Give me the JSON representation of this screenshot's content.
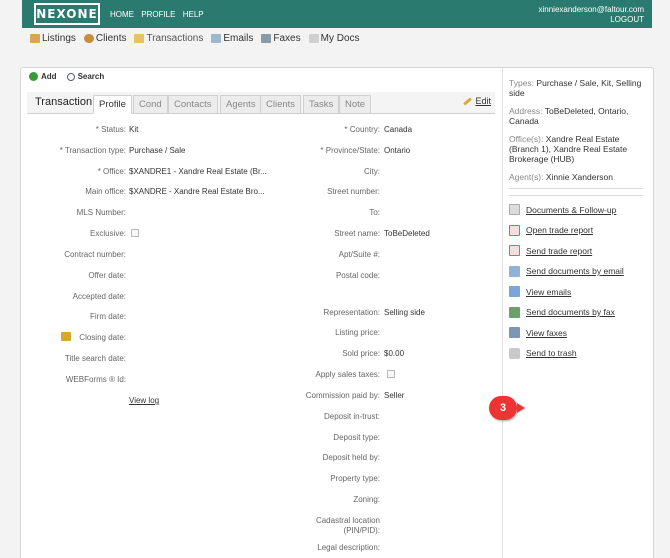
{
  "header": {
    "logo": "NEXONE",
    "nav": [
      "HOME",
      "PROFILE",
      "HELP"
    ],
    "user_email": "xinniexanderson@faltour.com",
    "logout": "LOGOUT"
  },
  "subnav": {
    "items": [
      {
        "label": "Listings",
        "icon": "house-icon"
      },
      {
        "label": "Clients",
        "icon": "people-icon"
      },
      {
        "label": "Transactions",
        "icon": "folder-icon"
      },
      {
        "label": "Emails",
        "icon": "envelope-icon"
      },
      {
        "label": "Faxes",
        "icon": "fax-icon"
      },
      {
        "label": "My Docs",
        "icon": "documents-icon"
      }
    ]
  },
  "actions": {
    "add": "Add",
    "search": "Search"
  },
  "tabs": {
    "title": "Transaction",
    "items": [
      "Profile",
      "Cond",
      "Contacts",
      "Agents",
      "Clients",
      "Tasks",
      "Note"
    ],
    "edit": "Edit"
  },
  "left_fields": [
    {
      "label": "* Status:",
      "value": "Kit"
    },
    {
      "label": "* Transaction type:",
      "value": "Purchase / Sale"
    },
    {
      "label": "* Office:",
      "value": "$XANDRE1 - Xandre Real Estate (Br..."
    },
    {
      "label": "Main office:",
      "value": "$XANDRE - Xandre Real Estate Bro..."
    },
    {
      "label": "MLS Number:",
      "value": ""
    },
    {
      "label": "Exclusive:",
      "value": ""
    },
    {
      "label": "Contract number:",
      "value": ""
    },
    {
      "label": "Offer date:",
      "value": ""
    },
    {
      "label": "Accepted date:",
      "value": ""
    },
    {
      "label": "Firm date:",
      "value": ""
    },
    {
      "label": "Closing date:",
      "value": ""
    },
    {
      "label": "Title search date:",
      "value": ""
    },
    {
      "label": "WEBForms ® Id:",
      "value": ""
    }
  ],
  "view_log": "View log",
  "right_fields": [
    {
      "label": "* Country:",
      "value": "Canada"
    },
    {
      "label": "* Province/State:",
      "value": "Ontario"
    },
    {
      "label": "City:",
      "value": ""
    },
    {
      "label": "Street number:",
      "value": ""
    },
    {
      "label": "To:",
      "value": ""
    },
    {
      "label": "Street name:",
      "value": "ToBeDeleted"
    },
    {
      "label": "Apt/Suite #:",
      "value": ""
    },
    {
      "label": "Postal code:",
      "value": ""
    },
    {
      "label": "Representation:",
      "value": "Selling side"
    },
    {
      "label": "Listing price:",
      "value": ""
    },
    {
      "label": "Sold price:",
      "value": "$0.00"
    },
    {
      "label": "Apply sales taxes:",
      "value": ""
    },
    {
      "label": "Commission paid by:",
      "value": "Seller"
    },
    {
      "label": "Deposit in-trust:",
      "value": ""
    },
    {
      "label": "Deposit type:",
      "value": ""
    },
    {
      "label": "Deposit held by:",
      "value": ""
    },
    {
      "label": "Property type:",
      "value": ""
    },
    {
      "label": "Zoning:",
      "value": ""
    },
    {
      "label": "Cadastral location (PIN/PID):",
      "value": ""
    },
    {
      "label": "Legal description:",
      "value": ""
    }
  ],
  "summary": {
    "types_k": "Types:",
    "types_v": "Purchase / Sale, Kit, Selling side",
    "address_k": "Address:",
    "address_v": "ToBeDeleted, Ontario, Canada",
    "offices_k": "Office(s):",
    "offices_v": "Xandre Real Estate (Branch 1), Xandre Real Estate Brokerage (HUB)",
    "agents_k": "Agent(s):",
    "agents_v": "Xinnie Xanderson"
  },
  "side_links": [
    {
      "label": "Documents",
      "label2": "Follow-up",
      "joiner": "&",
      "icon": "documents-icon"
    },
    {
      "label": "Open trade report",
      "icon": "report-icon"
    },
    {
      "label": "Send trade report",
      "icon": "send-report-icon"
    },
    {
      "label": "Send documents by email",
      "icon": "email-icon"
    },
    {
      "label": "View emails",
      "icon": "inbox-icon"
    },
    {
      "label": "Send documents by fax",
      "icon": "fax-icon"
    },
    {
      "label": "View faxes",
      "icon": "fax-view-icon"
    },
    {
      "label": "Send to trash",
      "icon": "trash-icon"
    }
  ],
  "callout": "3",
  "colors": {
    "header": "#2b7a6f",
    "callout": "#e33333"
  }
}
